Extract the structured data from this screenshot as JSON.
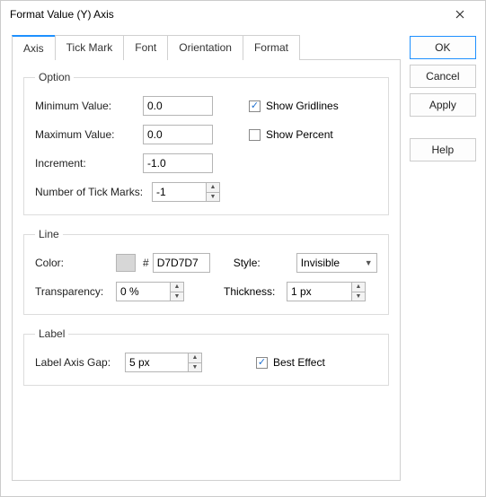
{
  "window": {
    "title": "Format Value (Y) Axis"
  },
  "tabs": {
    "items": [
      {
        "label": "Axis"
      },
      {
        "label": "Tick Mark"
      },
      {
        "label": "Font"
      },
      {
        "label": "Orientation"
      },
      {
        "label": "Format"
      }
    ]
  },
  "buttons": {
    "ok": "OK",
    "cancel": "Cancel",
    "apply": "Apply",
    "help": "Help"
  },
  "option": {
    "legend": "Option",
    "min_label": "Minimum Value:",
    "min_value": "0.0",
    "max_label": "Maximum Value:",
    "max_value": "0.0",
    "increment_label": "Increment:",
    "increment_value": "-1.0",
    "ticks_label": "Number of Tick Marks:",
    "ticks_value": "-1",
    "show_gridlines_label": "Show Gridlines",
    "show_gridlines_checked": true,
    "show_percent_label": "Show Percent",
    "show_percent_checked": false
  },
  "line": {
    "legend": "Line",
    "color_label": "Color:",
    "hash": "#",
    "hex_value": "D7D7D7",
    "style_label": "Style:",
    "style_value": "Invisible",
    "transparency_label": "Transparency:",
    "transparency_value": "0 %",
    "thickness_label": "Thickness:",
    "thickness_value": "1 px"
  },
  "label_group": {
    "legend": "Label",
    "gap_label": "Label Axis Gap:",
    "gap_value": "5 px",
    "best_effect_label": "Best Effect",
    "best_effect_checked": true
  }
}
